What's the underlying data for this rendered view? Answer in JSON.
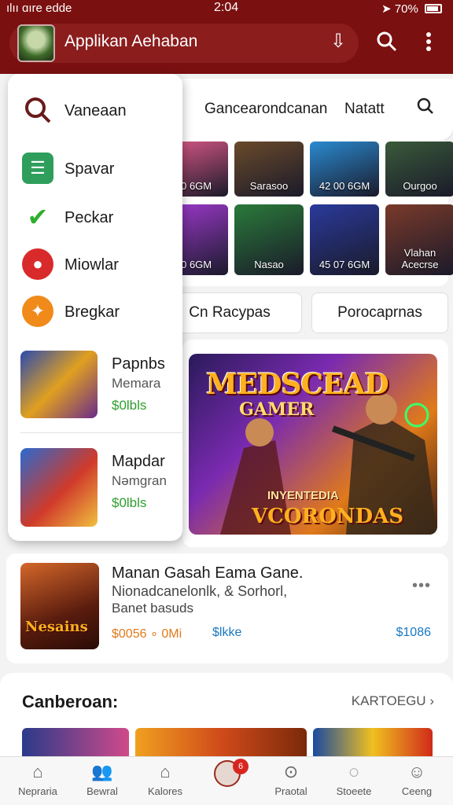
{
  "status_bar": {
    "carrier": "ılıı ɑıre edde",
    "time": "2:04",
    "battery": "70%"
  },
  "app_bar": {
    "title": "Applikan Aehaban"
  },
  "drawer": {
    "menu": [
      {
        "label": "Vaneaan",
        "icon": "search-icon",
        "color": "#6a1a1a"
      },
      {
        "label": "Spavar",
        "icon": "list-icon",
        "color": "#2f9e5c"
      },
      {
        "label": "Peckar",
        "icon": "check-icon",
        "color": "#2fae2f"
      },
      {
        "label": "Miowlar",
        "icon": "pin-icon",
        "color": "#d82a2a"
      },
      {
        "label": "Bregkar",
        "icon": "star-icon",
        "color": "#f08a1a"
      }
    ],
    "games": [
      {
        "name": "Papnbs",
        "developer": "Memara",
        "price": "$0lbls"
      },
      {
        "name": "Mapdar",
        "developer": "Nəmgran",
        "price": "$0lbls"
      }
    ]
  },
  "top_strip": {
    "tab1": "Gancearondcanan",
    "tab2": "Natatt"
  },
  "tiles": [
    {
      "label": "10 6GM",
      "color": "#e05a8a"
    },
    {
      "label": "Sarasoo",
      "color": "#6a4a2a"
    },
    {
      "label": "42 00 6GM",
      "color": "#2a8ad0"
    },
    {
      "label": "Ourgoo",
      "color": "#3a5a3a"
    },
    {
      "label": "10 6GM",
      "color": "#a03ad0"
    },
    {
      "label": "Nasao",
      "color": "#2a7a3a"
    },
    {
      "label": "45 07 6GM",
      "color": "#2a3a9a"
    },
    {
      "label": "Vlahan Acecrse",
      "color": "#7a3a2a"
    }
  ],
  "chips": [
    "Cn Racypas",
    "Porocaprnas"
  ],
  "feature": {
    "title_top": "MEDSCEAD",
    "title_mid": "GAMER",
    "footer_small": "INYENTEDIA",
    "footer_big": "VCORONDAS"
  },
  "big_row": {
    "thumb_text": "Nesains",
    "title": "Manan Gasah Eama Gane.",
    "subtitle1": "Nionadcanelonlk, & Sorhorl,",
    "subtitle2": "Banet basuds",
    "price_orange": "$0056 ∘ 0Mi",
    "price_blue": "$lkke",
    "price_right": "$1086",
    "more": "•••"
  },
  "section": {
    "title": "Canberoan:",
    "link": "KARTOEGU"
  },
  "bottom_nav": [
    {
      "label": "Nepraria",
      "icon": "home-icon"
    },
    {
      "label": "Bewral",
      "icon": "people-icon"
    },
    {
      "label": "Kalores",
      "icon": "bag-icon"
    },
    {
      "label": "Praotal",
      "icon": "search-icon"
    },
    {
      "label": "Stoeete",
      "icon": "chat-icon"
    },
    {
      "label": "Ceeng",
      "icon": "user-icon"
    }
  ],
  "badge_count": "6"
}
